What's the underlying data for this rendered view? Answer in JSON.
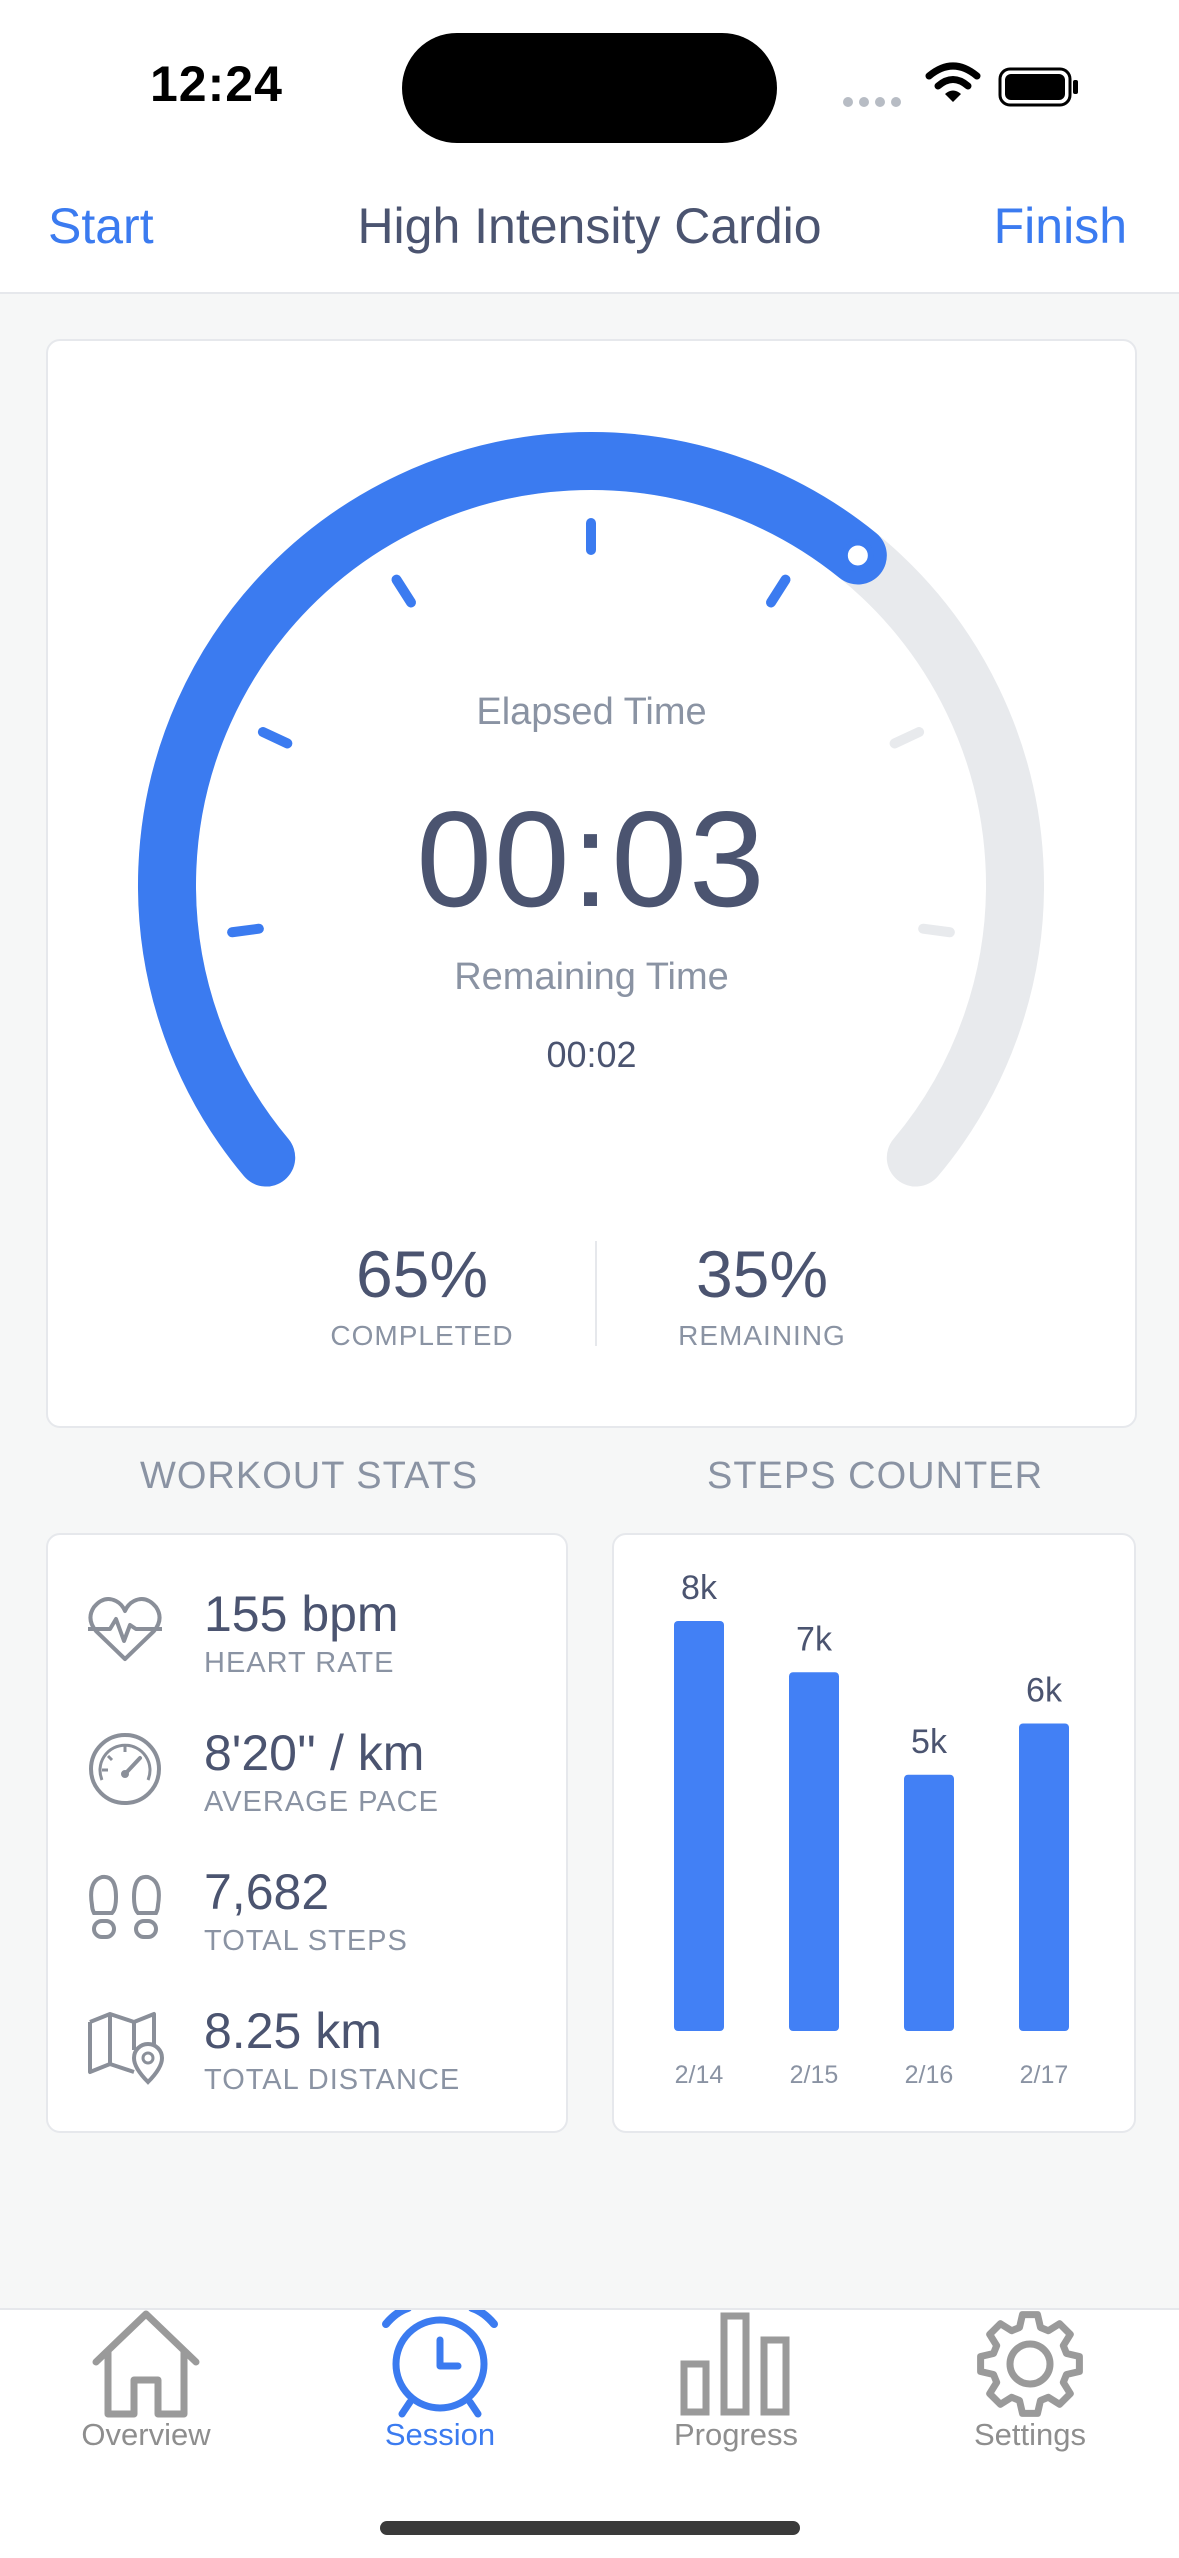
{
  "status_bar": {
    "time": "12:24"
  },
  "nav": {
    "left": "Start",
    "title": "High Intensity Cardio",
    "right": "Finish"
  },
  "timer": {
    "elapsed_label": "Elapsed Time",
    "elapsed_value": "00:03",
    "remaining_label": "Remaining Time",
    "remaining_value": "00:02",
    "progress_fraction": 0.65
  },
  "summary": {
    "completed_value": "65%",
    "completed_label": "COMPLETED",
    "remaining_value": "35%",
    "remaining_label": "REMAINING"
  },
  "workout_stats": {
    "title": "WORKOUT STATS",
    "items": [
      {
        "icon": "heart-pulse-icon",
        "value": "155 bpm",
        "label": "HEART RATE"
      },
      {
        "icon": "speedometer-icon",
        "value": "8'20'' / km",
        "label": "AVERAGE PACE"
      },
      {
        "icon": "footprints-icon",
        "value": "7,682",
        "label": "TOTAL STEPS"
      },
      {
        "icon": "map-pin-icon",
        "value": "8.25 km",
        "label": "TOTAL DISTANCE"
      }
    ]
  },
  "steps_counter": {
    "title": "STEPS COUNTER"
  },
  "chart_data": {
    "type": "bar",
    "categories": [
      "2/14",
      "2/15",
      "2/16",
      "2/17"
    ],
    "values": [
      8,
      7,
      5,
      6
    ],
    "data_labels": [
      "8k",
      "7k",
      "5k",
      "6k"
    ],
    "ylim": [
      0,
      8
    ],
    "grid": false,
    "color": "#4280f5"
  },
  "tabs": [
    {
      "icon": "house-icon",
      "label": "Overview",
      "active": false
    },
    {
      "icon": "alarm-clock-icon",
      "label": "Session",
      "active": true
    },
    {
      "icon": "bar-chart-icon",
      "label": "Progress",
      "active": false
    },
    {
      "icon": "gear-icon",
      "label": "Settings",
      "active": false
    }
  ],
  "colors": {
    "accent": "#3b7bf0",
    "track": "#e8eaed",
    "text": "#4b5470",
    "muted": "#8a93a3"
  }
}
